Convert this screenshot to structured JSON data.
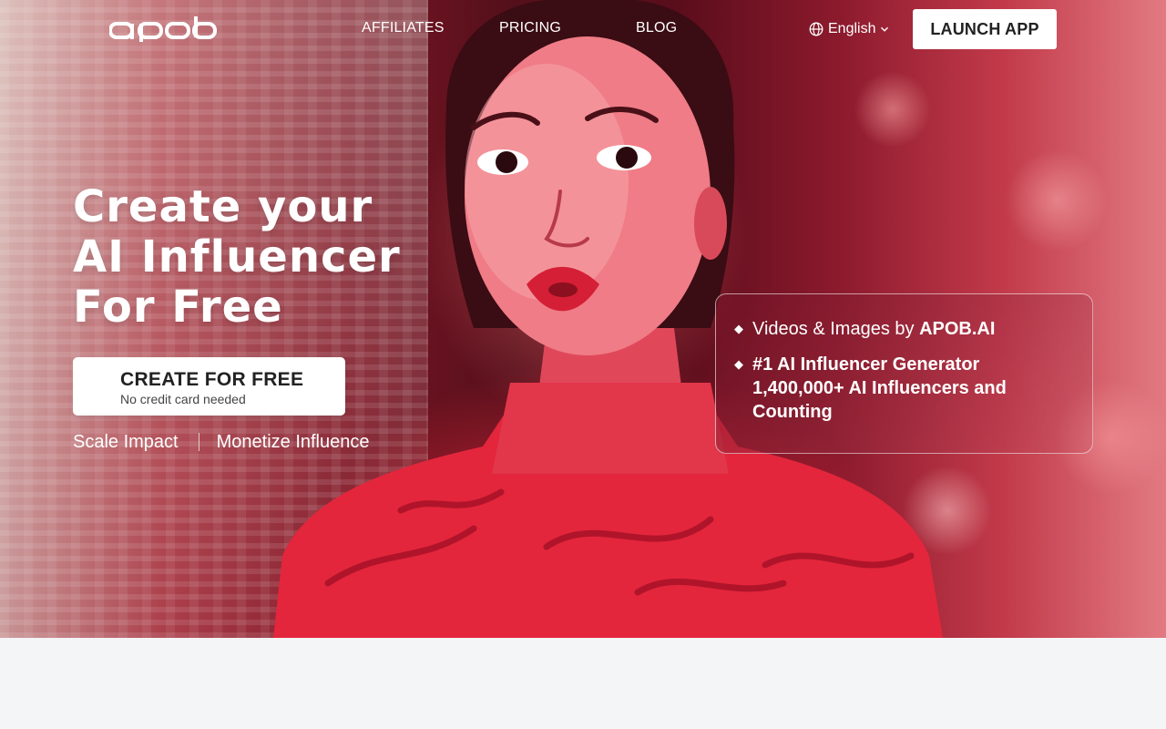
{
  "nav": {
    "logo_text": "apob",
    "links": [
      "AFFILIATES",
      "PRICING",
      "BLOG"
    ],
    "language": "English",
    "launch_label": "LAUNCH APP"
  },
  "hero": {
    "headline_lines": [
      "Create your",
      "AI Influencer",
      "For Free"
    ],
    "cta_label": "CREATE FOR FREE",
    "cta_sublabel": "No credit card needed",
    "taglines": [
      "Scale Impact",
      "Monetize Influence"
    ]
  },
  "info_card": {
    "line1_prefix": "Videos & Images by ",
    "line1_brand": "APOB.AI",
    "line2_lines": [
      "#1 AI Influencer Generator",
      "1,400,000+ AI Influencers and",
      "Counting"
    ]
  },
  "icons": {
    "globe": "globe-icon",
    "chevron": "chevron-down-icon",
    "bullet": "diamond-bullet-icon"
  },
  "colors": {
    "hero_red": "#e8263c",
    "white": "#ffffff",
    "page_bg": "#f4f5f7"
  }
}
